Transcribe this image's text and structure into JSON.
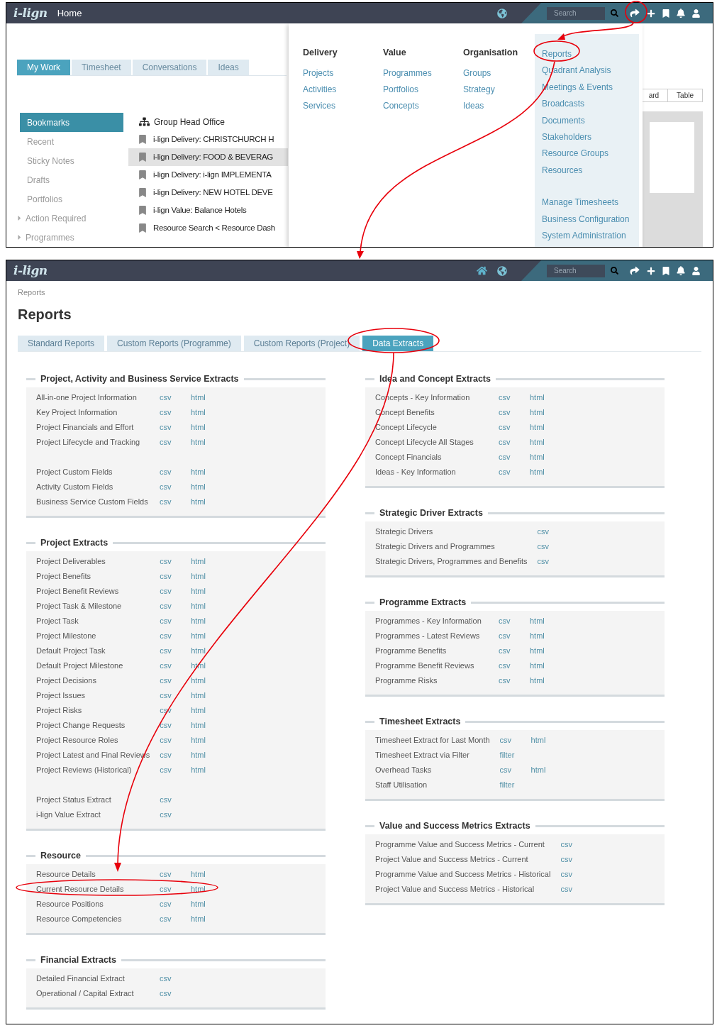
{
  "home_screen": {
    "header": {
      "logo": "i-lign",
      "title": "Home",
      "search": {
        "placeholder": "Search"
      }
    },
    "tabs": [
      {
        "label": "My Work",
        "selected": true
      },
      {
        "label": "Timesheet",
        "selected": false
      },
      {
        "label": "Conversations",
        "selected": false
      },
      {
        "label": "Ideas",
        "selected": false
      }
    ],
    "sidebar": [
      {
        "label": "Bookmarks",
        "kind": "link",
        "selected": true
      },
      {
        "label": "Recent",
        "kind": "link",
        "selected": false
      },
      {
        "label": "Sticky Notes",
        "kind": "link",
        "selected": false
      },
      {
        "label": "Drafts",
        "kind": "link",
        "selected": false
      },
      {
        "label": "Portfolios",
        "kind": "link",
        "selected": false
      },
      {
        "label": "Action Required",
        "kind": "folder",
        "selected": false
      },
      {
        "label": "Programmes",
        "kind": "folder",
        "selected": false
      }
    ],
    "bookmarks": [
      {
        "label": "Group Head Office",
        "kind": "group",
        "selected": false
      },
      {
        "label": "i-lign Delivery: CHRISTCHURCH H",
        "kind": "bookmark",
        "selected": false
      },
      {
        "label": "i-lign Delivery: FOOD & BEVERAG",
        "kind": "bookmark",
        "selected": true
      },
      {
        "label": "i-lign Delivery: i-lign IMPLEMENTA",
        "kind": "bookmark",
        "selected": false
      },
      {
        "label": "i-lign Delivery: NEW HOTEL DEVE",
        "kind": "bookmark",
        "selected": false
      },
      {
        "label": "i-lign Value: Balance Hotels",
        "kind": "bookmark",
        "selected": false
      },
      {
        "label": "Resource Search < Resource Dash",
        "kind": "bookmark",
        "selected": false
      }
    ],
    "view_toggle": [
      "ard",
      "Table"
    ],
    "menu": {
      "columns": [
        {
          "heading": "Delivery",
          "items": [
            "Projects",
            "Activities",
            "Services"
          ]
        },
        {
          "heading": "Value",
          "items": [
            "Programmes",
            "Portfolios",
            "Concepts"
          ]
        },
        {
          "heading": "Organisation",
          "items": [
            "Groups",
            "Strategy",
            "Ideas"
          ]
        }
      ],
      "side_groups": [
        [
          "Reports",
          "Quadrant Analysis",
          "Meetings & Events",
          "Broadcasts",
          "Documents",
          "Stakeholders",
          "Resource Groups",
          "Resources"
        ],
        [
          "Manage Timesheets",
          "Business Configuration",
          "System Administration"
        ]
      ]
    }
  },
  "reports_screen": {
    "header": {
      "logo": "i-lign",
      "search": {
        "placeholder": "Search"
      }
    },
    "breadcrumb": "Reports",
    "title": "Reports",
    "tabs": [
      {
        "label": "Standard Reports",
        "selected": false
      },
      {
        "label": "Custom Reports (Programme)",
        "selected": false
      },
      {
        "label": "Custom Reports (Project)",
        "selected": false
      },
      {
        "label": "Data Extracts",
        "selected": true
      }
    ],
    "columns": [
      [
        {
          "title": "Project, Activity and Business Service Extracts",
          "groups": [
            [
              {
                "name": "All-in-one Project Information",
                "links": [
                  "csv",
                  "html"
                ]
              },
              {
                "name": "Key Project Information",
                "links": [
                  "csv",
                  "html"
                ]
              },
              {
                "name": "Project Financials and Effort",
                "links": [
                  "csv",
                  "html"
                ]
              },
              {
                "name": "Project Lifecycle and Tracking",
                "links": [
                  "csv",
                  "html"
                ]
              }
            ],
            [
              {
                "name": "Project Custom Fields",
                "links": [
                  "csv",
                  "html"
                ]
              },
              {
                "name": "Activity Custom Fields",
                "links": [
                  "csv",
                  "html"
                ]
              },
              {
                "name": "Business Service Custom Fields",
                "links": [
                  "csv",
                  "html"
                ]
              }
            ]
          ]
        },
        {
          "title": "Project Extracts",
          "groups": [
            [
              {
                "name": "Project Deliverables",
                "links": [
                  "csv",
                  "html"
                ]
              },
              {
                "name": "Project Benefits",
                "links": [
                  "csv",
                  "html"
                ]
              },
              {
                "name": "Project Benefit Reviews",
                "links": [
                  "csv",
                  "html"
                ]
              },
              {
                "name": "Project Task & Milestone",
                "links": [
                  "csv",
                  "html"
                ]
              },
              {
                "name": "Project Task",
                "links": [
                  "csv",
                  "html"
                ]
              },
              {
                "name": "Project Milestone",
                "links": [
                  "csv",
                  "html"
                ]
              },
              {
                "name": "Default Project Task",
                "links": [
                  "csv",
                  "html"
                ]
              },
              {
                "name": "Default Project Milestone",
                "links": [
                  "csv",
                  "html"
                ]
              },
              {
                "name": "Project Decisions",
                "links": [
                  "csv",
                  "html"
                ]
              },
              {
                "name": "Project Issues",
                "links": [
                  "csv",
                  "html"
                ]
              },
              {
                "name": "Project Risks",
                "links": [
                  "csv",
                  "html"
                ]
              },
              {
                "name": "Project Change Requests",
                "links": [
                  "csv",
                  "html"
                ]
              },
              {
                "name": "Project Resource Roles",
                "links": [
                  "csv",
                  "html"
                ]
              },
              {
                "name": "Project Latest and Final Reviews",
                "links": [
                  "csv",
                  "html"
                ]
              },
              {
                "name": "Project Reviews (Historical)",
                "links": [
                  "csv",
                  "html"
                ]
              }
            ],
            [
              {
                "name": "Project Status Extract",
                "links": [
                  "csv"
                ]
              },
              {
                "name": "i-lign Value Extract",
                "links": [
                  "csv"
                ]
              }
            ]
          ]
        },
        {
          "title": "Resource",
          "groups": [
            [
              {
                "name": "Resource Details",
                "links": [
                  "csv",
                  "html"
                ]
              },
              {
                "name": "Current Resource Details",
                "links": [
                  "csv",
                  "html"
                ]
              },
              {
                "name": "Resource Positions",
                "links": [
                  "csv",
                  "html"
                ]
              },
              {
                "name": "Resource Competencies",
                "links": [
                  "csv",
                  "html"
                ]
              }
            ]
          ]
        },
        {
          "title": "Financial Extracts",
          "groups": [
            [
              {
                "name": "Detailed Financial Extract",
                "links": [
                  "csv"
                ]
              },
              {
                "name": "Operational / Capital Extract",
                "links": [
                  "csv"
                ]
              }
            ]
          ]
        }
      ],
      [
        {
          "title": "Idea and Concept Extracts",
          "groups": [
            [
              {
                "name": "Concepts - Key Information",
                "links": [
                  "csv",
                  "html"
                ]
              },
              {
                "name": "Concept Benefits",
                "links": [
                  "csv",
                  "html"
                ]
              },
              {
                "name": "Concept Lifecycle",
                "links": [
                  "csv",
                  "html"
                ]
              },
              {
                "name": "Concept Lifecycle All Stages",
                "links": [
                  "csv",
                  "html"
                ]
              },
              {
                "name": "Concept Financials",
                "links": [
                  "csv",
                  "html"
                ]
              },
              {
                "name": "Ideas - Key Information",
                "links": [
                  "csv",
                  "html"
                ]
              }
            ]
          ]
        },
        {
          "title": "Strategic Driver Extracts",
          "groups": [
            [
              {
                "name": "Strategic Drivers",
                "links": [
                  "csv"
                ]
              },
              {
                "name": "Strategic Drivers and Programmes",
                "links": [
                  "csv"
                ]
              },
              {
                "name": "Strategic Drivers, Programmes and Benefits",
                "links": [
                  "csv"
                ]
              }
            ]
          ]
        },
        {
          "title": "Programme Extracts",
          "groups": [
            [
              {
                "name": "Programmes - Key Information",
                "links": [
                  "csv",
                  "html"
                ]
              },
              {
                "name": "Programmes - Latest Reviews",
                "links": [
                  "csv",
                  "html"
                ]
              },
              {
                "name": "Programme Benefits",
                "links": [
                  "csv",
                  "html"
                ]
              },
              {
                "name": "Programme Benefit Reviews",
                "links": [
                  "csv",
                  "html"
                ]
              },
              {
                "name": "Programme Risks",
                "links": [
                  "csv",
                  "html"
                ]
              }
            ]
          ]
        },
        {
          "title": "Timesheet Extracts",
          "groups": [
            [
              {
                "name": "Timesheet Extract for Last Month",
                "links": [
                  "csv",
                  "html"
                ]
              },
              {
                "name": "Timesheet Extract via Filter",
                "links": [
                  "filter"
                ]
              },
              {
                "name": "Overhead Tasks",
                "links": [
                  "csv",
                  "html"
                ]
              },
              {
                "name": "Staff Utilisation",
                "links": [
                  "filter"
                ]
              }
            ]
          ]
        },
        {
          "title": "Value and Success Metrics Extracts",
          "groups": [
            [
              {
                "name": "Programme Value and Success Metrics - Current",
                "links": [
                  "csv"
                ]
              },
              {
                "name": "Project Value and Success Metrics - Current",
                "links": [
                  "csv"
                ]
              },
              {
                "name": "Programme Value and Success Metrics - Historical",
                "links": [
                  "csv"
                ]
              },
              {
                "name": "Project Value and Success Metrics - Historical",
                "links": [
                  "csv"
                ]
              }
            ]
          ]
        }
      ]
    ]
  }
}
